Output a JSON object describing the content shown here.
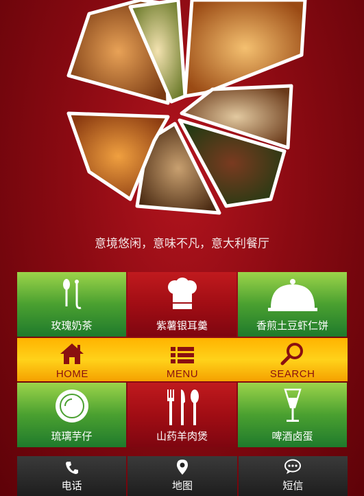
{
  "slogan": "意境悠闲，意味不凡，意大利餐厅",
  "menu_rows": [
    [
      {
        "label": "玫瑰奶茶",
        "icon": "spoon-icon",
        "color": "green"
      },
      {
        "label": "紫薯银耳羹",
        "icon": "chef-hat-icon",
        "color": "red"
      },
      {
        "label": "香煎土豆虾仁饼",
        "icon": "cloche-icon",
        "color": "green"
      }
    ],
    [
      {
        "label": "琉璃芋仔",
        "icon": "plate-icon",
        "color": "green"
      },
      {
        "label": "山药羊肉煲",
        "icon": "cutlery-icon",
        "color": "red"
      },
      {
        "label": "啤酒卤蛋",
        "icon": "wine-glass-icon",
        "color": "green"
      }
    ]
  ],
  "nav": [
    {
      "label": "HOME",
      "icon": "home-icon"
    },
    {
      "label": "MENU",
      "icon": "list-icon"
    },
    {
      "label": "SEARCH",
      "icon": "search-icon"
    }
  ],
  "bottom": [
    {
      "label": "电话",
      "icon": "phone-icon"
    },
    {
      "label": "地图",
      "icon": "map-pin-icon"
    },
    {
      "label": "短信",
      "icon": "message-icon"
    }
  ],
  "colors": {
    "accent": "#ffc20e",
    "nav_text": "#8a1010",
    "tile_red": "#a10d14",
    "tile_green": "#4aa030"
  }
}
